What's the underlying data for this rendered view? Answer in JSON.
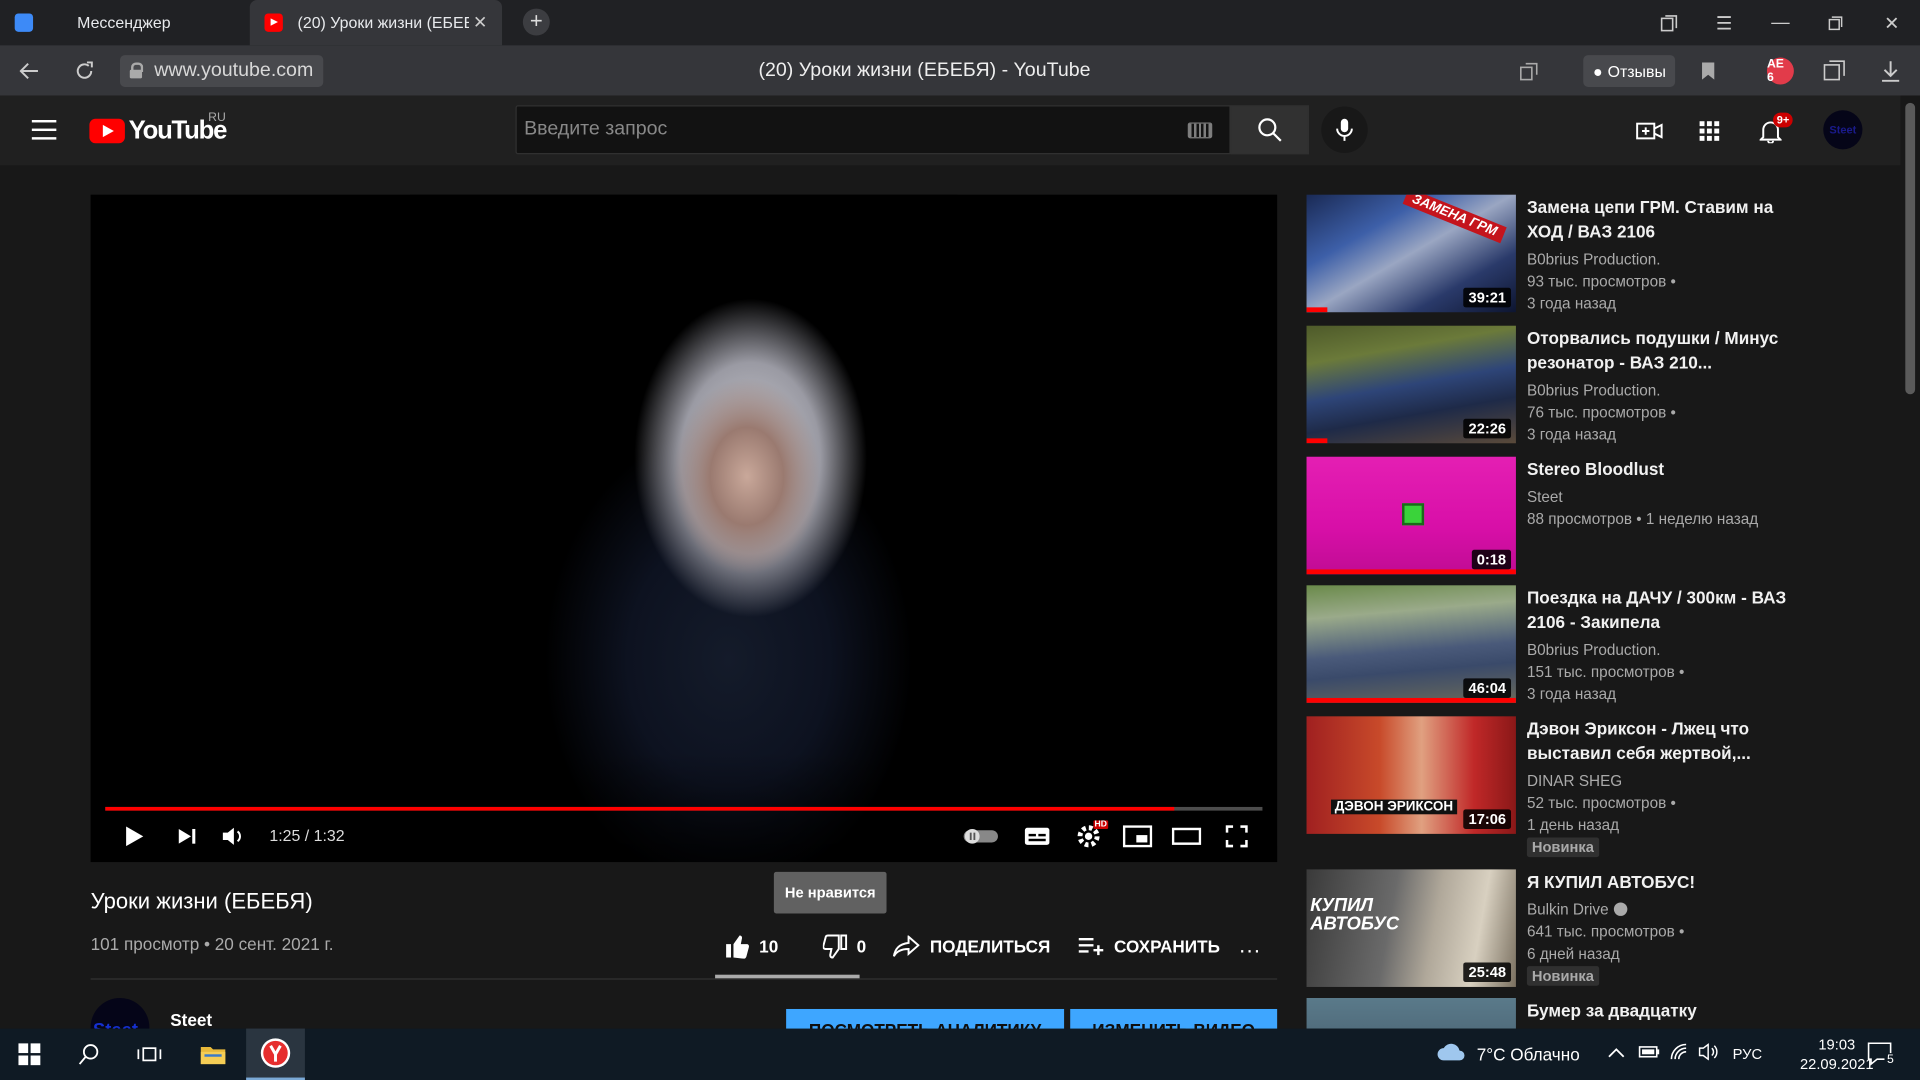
{
  "browser": {
    "tabs": [
      {
        "label": "Мессенджер",
        "active": false
      },
      {
        "label": "(20) Уроки жизни (ЕБЕБЯ)",
        "active": true
      }
    ],
    "url": "www.youtube.com",
    "page_title": "(20) Уроки жизни (ЕБЕБЯ) - YouTube",
    "feedback_label": "Отзывы",
    "ext_badge": "AE 6"
  },
  "youtube": {
    "logo_text": "YouTube",
    "region": "RU",
    "search_placeholder": "Введите запрос",
    "notifications_badge": "9+",
    "avatar_text": "Steet"
  },
  "player": {
    "time_current": "1:25",
    "time_total": "1:32",
    "time_label": "1:25 / 1:32",
    "progress_fraction": 0.924,
    "hd_badge": "HD"
  },
  "tooltip": "Не нравится",
  "video": {
    "title": "Уроки жизни (ЕБЕБЯ)",
    "meta": "101 просмотр • 20 сент. 2021 г.",
    "likes": "10",
    "dislikes": "0",
    "share_label": "ПОДЕЛИТЬСЯ",
    "save_label": "СОХРАНИТЬ",
    "more_label": "..."
  },
  "channel": {
    "name": "Steet",
    "avatar_text": "Steet",
    "analytics_label": "ПОСМОТРЕТЬ АНАЛИТИКУ",
    "edit_label": "ИЗМЕНИТЬ ВИДЕО"
  },
  "recommendations": [
    {
      "title": "Замена цепи ГРМ. Ставим на ХОД / ВАЗ 2106",
      "channel": "B0brius Production.",
      "views": "93 тыс. просмотров •",
      "age": "3 года назад",
      "duration": "39:21",
      "watched_fraction": 0.1,
      "thumb_text": "ЗАМЕНА ГРМ",
      "new": ""
    },
    {
      "title": "Оторвались подушки / Минус резонатор - ВАЗ 210...",
      "channel": "B0brius Production.",
      "views": "76 тыс. просмотров •",
      "age": "3 года назад",
      "duration": "22:26",
      "watched_fraction": 0.1,
      "thumb_text": "",
      "new": ""
    },
    {
      "title": "Stereo Bloodlust",
      "channel": "Steet",
      "views": "88 просмотров • 1 неделю назад",
      "age": "",
      "duration": "0:18",
      "watched_fraction": 1.0,
      "thumb_text": "",
      "new": ""
    },
    {
      "title": "Поездка на ДАЧУ / 300км - ВАЗ 2106 - Закипела",
      "channel": "B0brius Production.",
      "views": "151 тыс. просмотров •",
      "age": "3 года назад",
      "duration": "46:04",
      "watched_fraction": 1.0,
      "thumb_text": "",
      "new": ""
    },
    {
      "title": "Дэвон Эриксон - Лжец что выставил себя жертвой,...",
      "channel": "DINAR SHEG",
      "views": "52 тыс. просмотров •",
      "age": "1 день назад",
      "duration": "17:06",
      "watched_fraction": 0,
      "thumb_text": "ДЭВОН ЭРИКСОН",
      "new": "Новинка"
    },
    {
      "title": "Я КУПИЛ АВТОБУС!",
      "channel": "Bulkin Drive",
      "views": "641 тыс. просмотров •",
      "age": "6 дней назад",
      "duration": "25:48",
      "watched_fraction": 0,
      "thumb_text": "КУПИЛ АВТОБУС",
      "new": "Новинка"
    },
    {
      "title": "Бумер за двадцатку",
      "channel": "",
      "views": "",
      "age": "",
      "duration": "",
      "watched_fraction": 0,
      "thumb_text": "",
      "new": ""
    }
  ],
  "taskbar": {
    "weather": "7°C  Облачно",
    "lang": "РУС",
    "time": "19:03",
    "date": "22.09.2021",
    "notif_count": "5"
  },
  "colors": {
    "accent": "#ff0000",
    "button_blue": "#3ea6ff",
    "background": "#181818"
  }
}
